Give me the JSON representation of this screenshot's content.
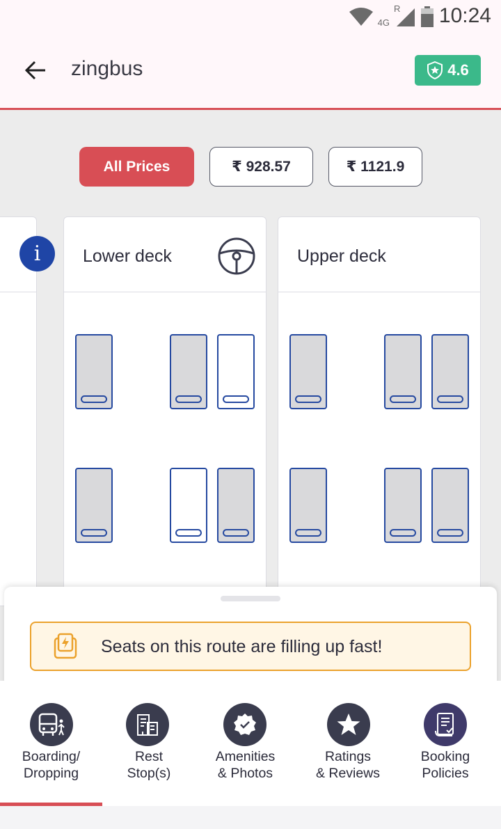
{
  "status_bar": {
    "time": "10:24",
    "network": "4G",
    "roaming": "R",
    "icons": [
      "wifi-icon",
      "cellular-signal-icon",
      "battery-icon"
    ]
  },
  "header": {
    "operator_name": "zingbus",
    "rating": "4.6",
    "icons": [
      "back-arrow-icon",
      "shield-star-icon"
    ]
  },
  "price_filters": [
    {
      "label": "All Prices",
      "selected": true
    },
    {
      "label": "₹ 928.57",
      "selected": false
    },
    {
      "label": "₹ 1121.9",
      "selected": false
    }
  ],
  "decks": {
    "lower": {
      "title": "Lower deck",
      "rows": [
        [
          "booked",
          "booked",
          "available"
        ],
        [
          "booked",
          "available",
          "booked"
        ]
      ]
    },
    "upper": {
      "title": "Upper deck",
      "rows": [
        [
          "booked",
          "booked",
          "booked"
        ],
        [
          "booked",
          "booked",
          "booked"
        ]
      ]
    }
  },
  "info_button": "i",
  "alert": {
    "text": "Seats on this route are filling up fast!"
  },
  "tabs": [
    {
      "label": "Boarding/\nDropping",
      "icon": "bus-boarding-icon",
      "active": true
    },
    {
      "label": "Rest\nStop(s)",
      "icon": "building-icon",
      "active": false
    },
    {
      "label": "Amenities\n& Photos",
      "icon": "badge-check-icon",
      "active": false
    },
    {
      "label": "Ratings\n& Reviews",
      "icon": "star-icon",
      "active": false
    },
    {
      "label": "Booking\nPolicies",
      "icon": "policy-document-icon",
      "active": false
    }
  ],
  "colors": {
    "accent": "#d84e55",
    "rating_green": "#3bb98a",
    "seat_border": "#2549a0",
    "seat_booked": "#d9d9db",
    "alert_border": "#eba12b",
    "alert_bg": "#fff6e5",
    "info_blue": "#1f45a6"
  }
}
